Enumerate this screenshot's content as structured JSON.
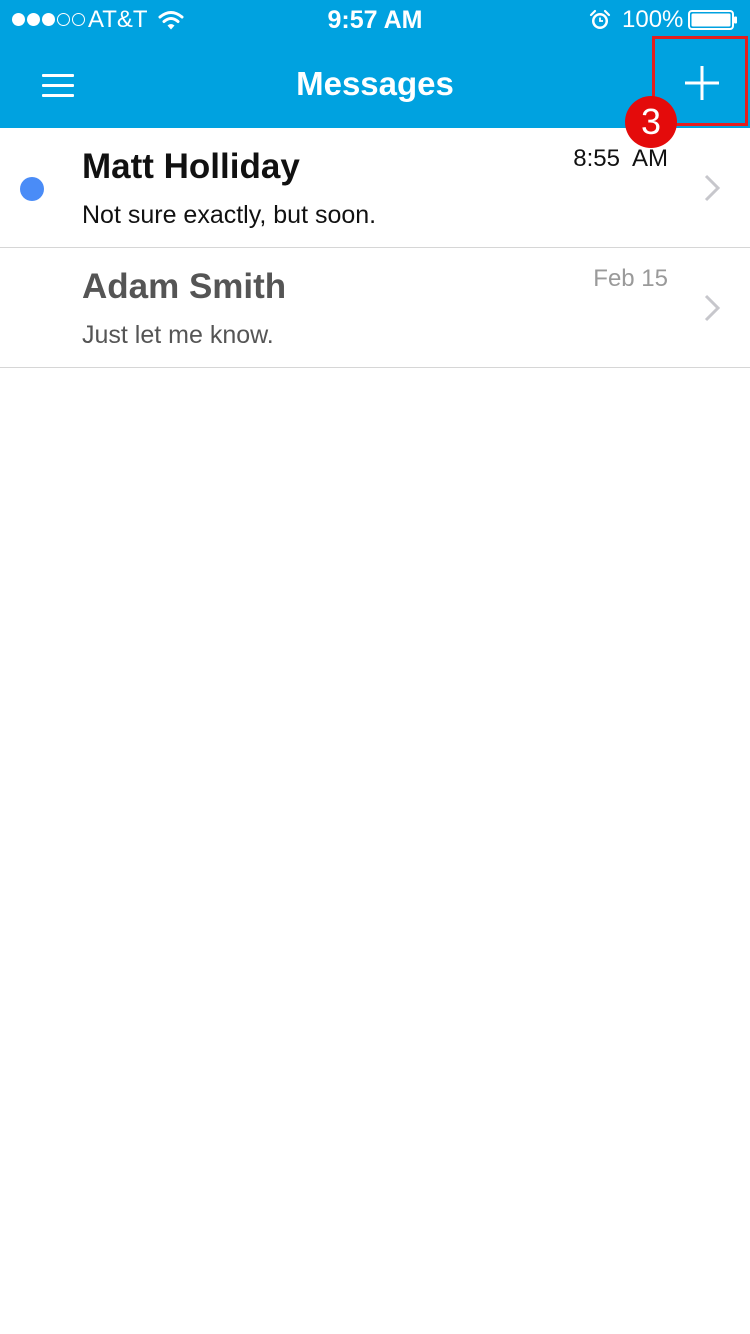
{
  "status_bar": {
    "carrier": "AT&T",
    "time": "9:57 AM",
    "battery": "100%",
    "signal_bars_filled": 3,
    "signal_bars_total": 5
  },
  "nav": {
    "title": "Messages",
    "menu_icon": "hamburger-menu-icon",
    "add_icon": "plus-icon",
    "step_badge": "3"
  },
  "messages": [
    {
      "name": "Matt Holliday",
      "preview": "Not sure exactly, but soon.",
      "time": "8:55  AM",
      "unread": true
    },
    {
      "name": "Adam Smith",
      "preview": "Just let me know.",
      "time": "Feb 15",
      "unread": false
    }
  ],
  "colors": {
    "header": "#00a2e0",
    "unread_dot": "#4a8cf7",
    "highlight": "#e41e1e"
  }
}
